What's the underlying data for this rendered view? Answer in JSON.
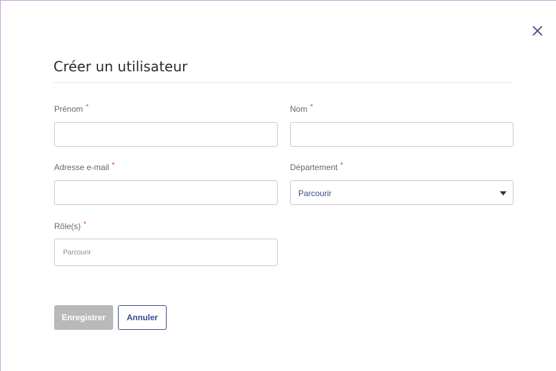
{
  "dialog": {
    "title": "Créer un utilisateur",
    "close_icon": "close-icon"
  },
  "form": {
    "first_name": {
      "label": "Prénom",
      "required_mark": "*",
      "value": ""
    },
    "last_name": {
      "label": "Nom",
      "required_mark": "*",
      "value": ""
    },
    "email": {
      "label": "Adresse e-mail",
      "required_mark": "*",
      "value": ""
    },
    "department": {
      "label": "Département",
      "required_mark": "*",
      "selected": "Parcourir"
    },
    "roles": {
      "label": "Rôle(s)",
      "required_mark": "*",
      "placeholder": "Parcourir"
    }
  },
  "actions": {
    "save_label": "Enregistrer",
    "cancel_label": "Annuler"
  },
  "colors": {
    "accent": "#3b4a8c",
    "required": "#e2483d",
    "disabled_button": "#b9b9b9",
    "frame_border": "#c79ed6"
  }
}
